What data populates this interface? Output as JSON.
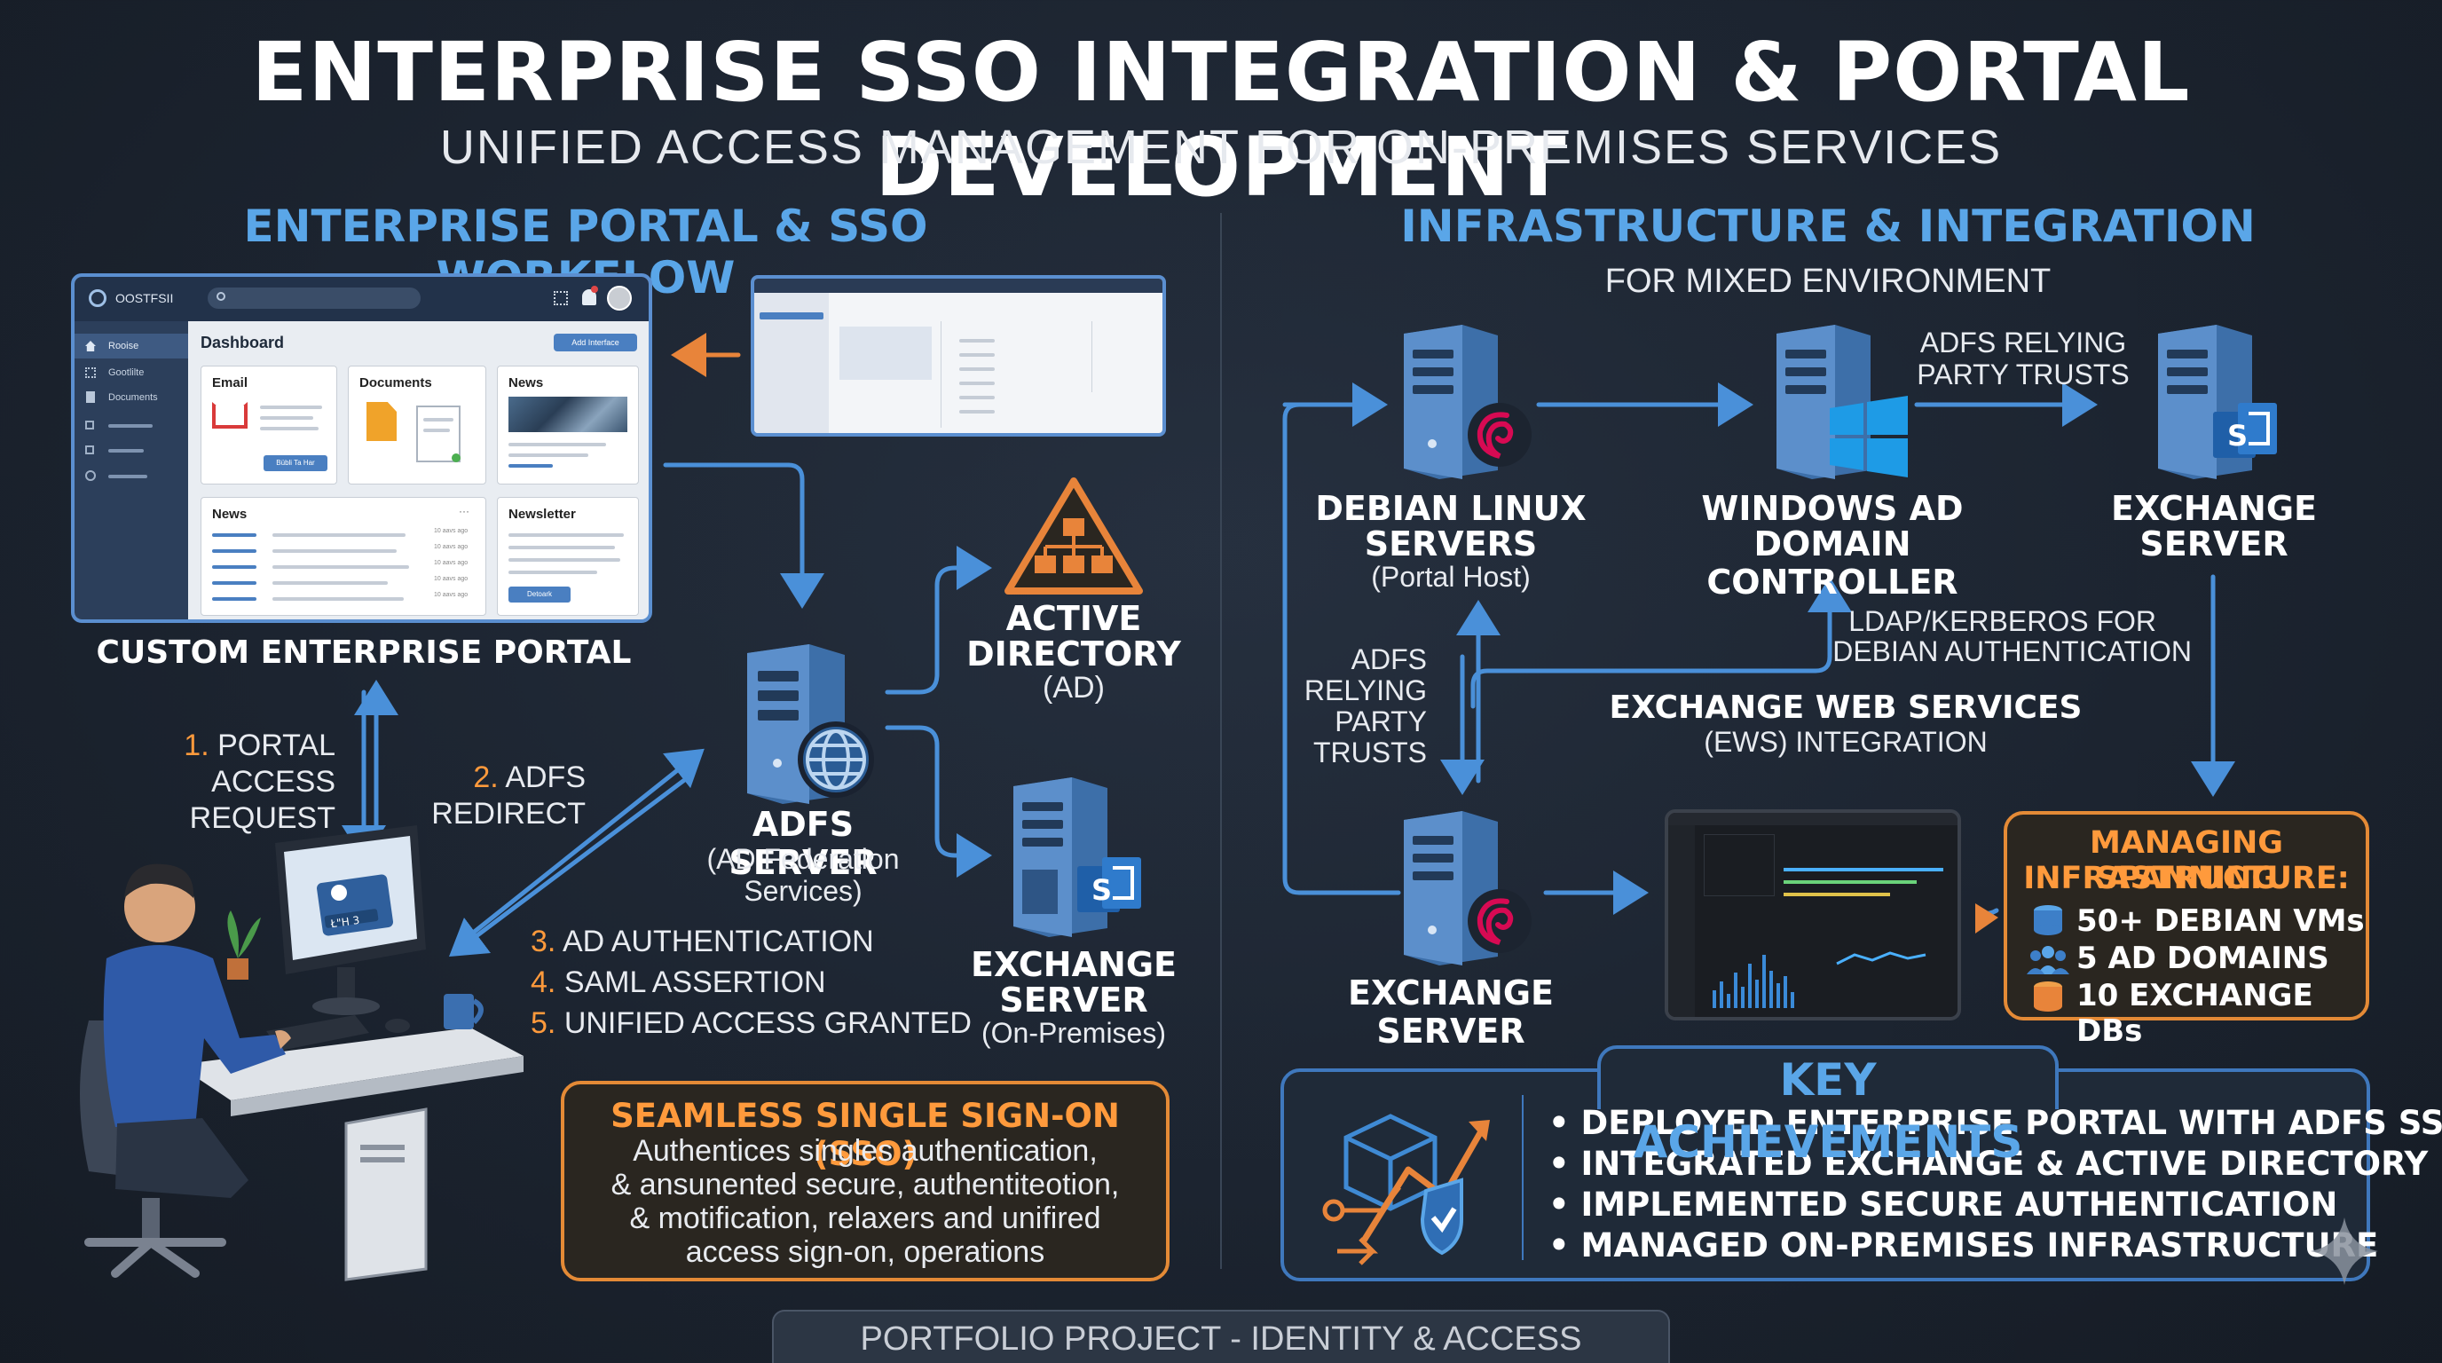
{
  "header": {
    "title": "ENTERPRISE SSO INTEGRATION & PORTAL DEVELOPMENT",
    "subtitle": "UNIFIED ACCESS MANAGEMENT FOR ON-PREMISES SERVICES"
  },
  "left": {
    "heading": "ENTERPRISE PORTAL & SSO WORKFLOW",
    "portal": {
      "brand": "OOSTFSII",
      "nav_home": "Rooise",
      "nav_2": "Gootlilte",
      "nav_3": "Documents",
      "dashboard_title": "Dashboard",
      "add_button": "Add Interface",
      "card_email": "Email",
      "card_documents": "Documents",
      "card_news": "News",
      "card_news2": "News",
      "card_newsletter": "Newsletter",
      "email_button": "Bübli Ta Har",
      "newsletter_button": "Detoark",
      "times": [
        "10 aavs ago",
        "10 aavs ago",
        "10 aavs ago",
        "10 aavs ago",
        "10 aavs ago"
      ]
    },
    "portal_label": "CUSTOM ENTERPRISE PORTAL",
    "step1_num": "1.",
    "step1_text_a": "PORTAL ACCESS",
    "step1_text_b": "REQUEST",
    "step2_num": "2.",
    "step2_text_a": "ADFS",
    "step2_text_b": "REDIRECT",
    "adfs_title": "ADFS SERVER",
    "adfs_sub_a": "(AD Federation",
    "adfs_sub_b": "Services)",
    "ad_title_a": "ACTIVE",
    "ad_title_b": "DIRECTORY",
    "ad_sub": "(AD)",
    "exchange_title_a": "EXCHANGE",
    "exchange_title_b": "SERVER",
    "exchange_sub": "(On-Premises)",
    "steps": [
      {
        "num": "3.",
        "text": "AD AUTHENTICATION"
      },
      {
        "num": "4.",
        "text": "SAML ASSERTION"
      },
      {
        "num": "5.",
        "text": "UNIFIED ACCESS GRANTED"
      }
    ],
    "sso_box": {
      "title": "SEAMLESS SINGLE SIGN-ON (SSO)",
      "line1": "Authentices singles authentication,",
      "line2": "& ansunented secure, authentiteotion,",
      "line3": "& motification, relaxers and unifired",
      "line4": "access sign-on, operations"
    },
    "login_button": "Ł\"H 3"
  },
  "right": {
    "heading": "INFRASTRUCTURE & INTEGRATION",
    "subheading": "FOR MIXED ENVIRONMENT",
    "debian_a": "DEBIAN LINUX",
    "debian_b": "SERVERS",
    "debian_sub": "(Portal Host)",
    "windows_a": "WINDOWS AD",
    "windows_b": "DOMAIN CONTROLLER",
    "exchange_a": "EXCHANGE",
    "exchange_b": "SERVER",
    "adfs_trusts_top_a": "ADFS RELYING",
    "adfs_trusts_top_b": "PARTY TRUSTS",
    "ldap_a": "LDAP/KERBEROS FOR",
    "ldap_b": "DEBIAN AUTHENTICATION",
    "adfs_trusts_left": [
      "ADFS",
      "RELYING",
      "PARTY",
      "TRUSTS"
    ],
    "ews_a": "EXCHANGE WEB SERVICES",
    "ews_b": "(EWS) INTEGRATION",
    "exchange_bottom": "EXCHANGE SERVER",
    "spanning": {
      "title_a": "MANAGING SPANNING",
      "title_b": "INFRASTRUCTURE:",
      "items": [
        "50+ DEBIAN VMs",
        "5 AD DOMAINS",
        "10 EXCHANGE DBs"
      ]
    },
    "achievements": {
      "title": "KEY ACHIEVEMENTS",
      "items": [
        "DEPLOYED ENTERPRISE PORTAL WITH ADFS SSO",
        "INTEGRATED EXCHANGE & ACTIVE DIRECTORY",
        "IMPLEMENTED SECURE AUTHENTICATION",
        "MANAGED ON-PREMISES INFRASTRUCTURE"
      ]
    }
  },
  "footer": "PORTFOLIO PROJECT - IDENTITY & ACCESS MANAGEMENT",
  "colors": {
    "background": "#1c2430",
    "accent_blue": "#5aa6e8",
    "accent_orange": "#ff9a3c",
    "arrow_blue": "#4a90d9",
    "arrow_orange": "#e8843a"
  }
}
